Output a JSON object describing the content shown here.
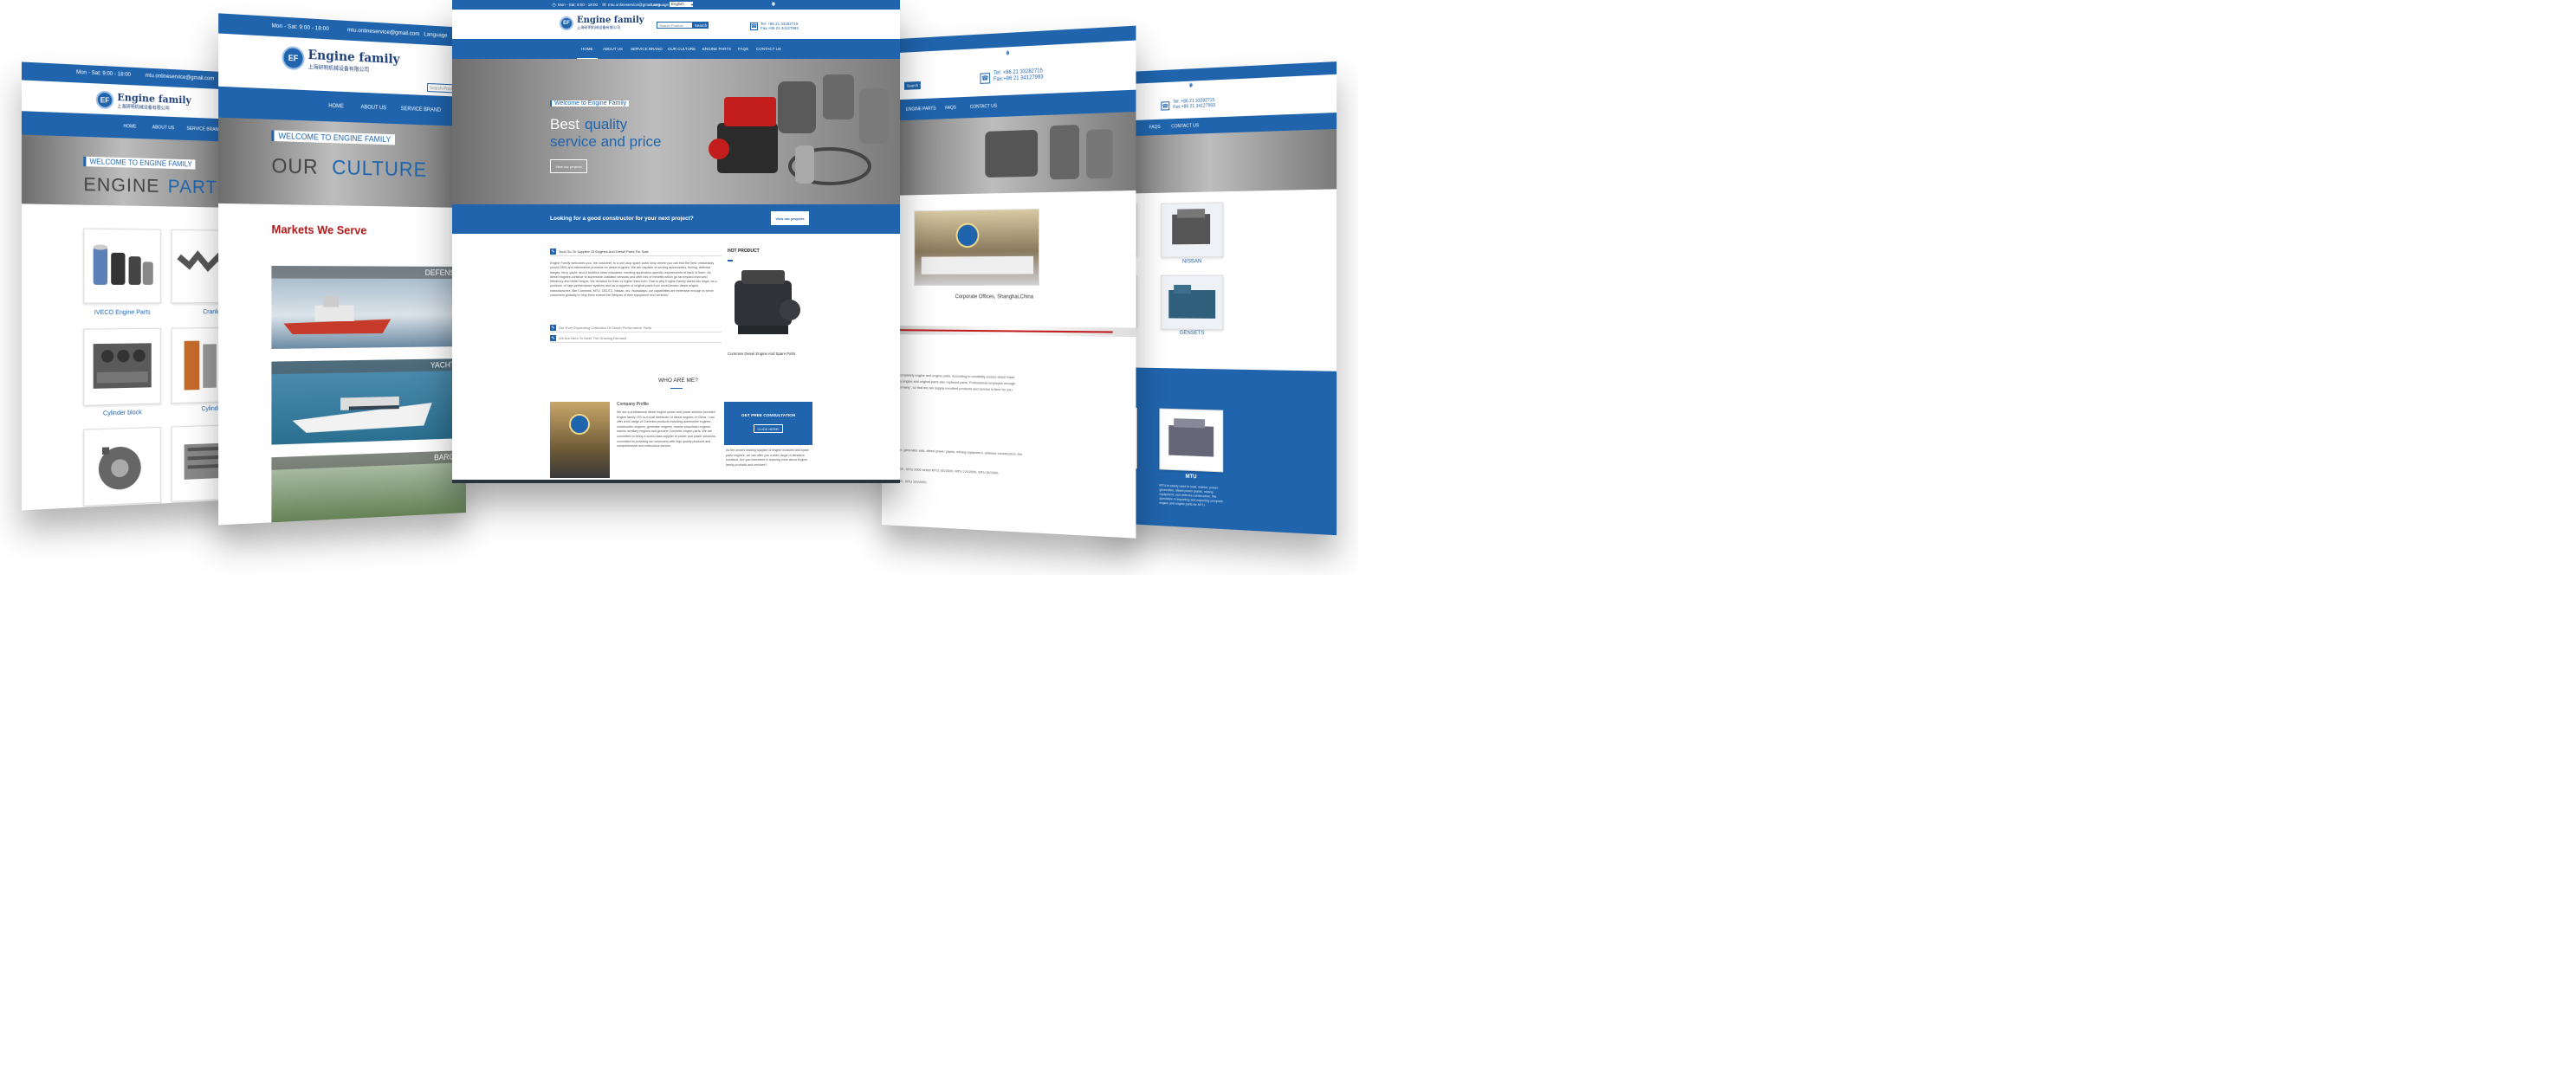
{
  "brand": {
    "name": "Engine family",
    "name_cn": "上海研明机械设备有限公司",
    "hours": "Mon - Sat: 9:00 - 18:00",
    "email": "mtu.onlineservice@gmail.com",
    "language_label": "Language",
    "language_value": "English",
    "search_placeholder": "Search Product",
    "search_button": "Search",
    "tel": "Tel: +86 21 33282715",
    "fax": "Fax:+86 21 34127993"
  },
  "colors": {
    "primary": "#1f64ad",
    "accent_red": "#c01d1d"
  },
  "social_icons": [
    "facebook-icon",
    "twitter-icon",
    "google-plus-icon",
    "pinterest-icon",
    "linkedin-icon"
  ],
  "center": {
    "nav": [
      "HOME",
      "ABOUT US",
      "SERVICE BRAND",
      "OUR CULTURE",
      "ENGINE PARTS",
      "FAQS",
      "CONTACT US"
    ],
    "hero": {
      "welcome": "Welcome to Engine Family",
      "line1a": "Best",
      "line1b": "quality",
      "line2": "service and price",
      "button": "View our projects"
    },
    "cta": {
      "text": "Looking for a good constructor for your next project?",
      "button": "View our projects"
    },
    "accordion": [
      {
        "title": "Your Go-To Supplier Of Engines And Diesel Parts For Sale"
      },
      {
        "title": "Our Ever-Expanding Collection Of Diesel Performance Parts"
      },
      {
        "title": "We Are Here To Meet The Growing Demand"
      }
    ],
    "intro_text": "Engine Family welcomes you, the customer, to a one-stop spare parts shop where you can find the best, reasonably priced OEM and aftermarket products for diesel engines. We are capable of serving automobiles, fishing, defense, barges, ferry, yacht, and a bevillion other industries, meeting application-specific requirements of each of them. As diesel engines continue to supersede outdated versions and offer lots of benefits which go far beyond improved efficiency and better torque, the demand for them is higher than ever. That is why Engine Family works two ways: as a producer of high-performance systems and as a supplier of original parts from world-known diesel engine manufacturers, like Cummins, MTU, DEUTZ, Nissan, etc. Nowadays, our capabilities are extensive enough to serve customers globally to help them extend the lifespan of their equipment and vehicles.",
    "hot_product": {
      "title": "HOT PRODUCT",
      "caption": "Cummins Diesel Engine And Spare Parts"
    },
    "who": {
      "title": "WHO ARE ME?",
      "profile_title": "Company Profile",
      "profile_text": "We are a professional diesel engine power and power solution provider! Engine family LTD is a local distributor of diesel engines in China. I can offer a full range of Cummins products including automotive engines, construction engines, generator engines, marine propulsion engines, marine auxiliary engines and genuine Cummins engine parts. We are committed to being a world-class supplier of power and power solutions, committed to providing our customers with high quality products and comprehensive and meticulous service.",
      "consult_title": "GET FREE CONSULTATION",
      "consult_button": "CLICK HERE!",
      "consult_text": "As the world's leading supplier of engine modules and spare parts engines, we can offer you a wide range of attractive solutions. Are you interested in learning more about Engine family products and services?"
    }
  },
  "left1": {
    "nav": [
      "HOME",
      "ABOUT US",
      "SERVICE BRAND"
    ],
    "welcome": "WELCOME TO ENGINE FAMILY",
    "title_a": "ENGINE",
    "title_b": "PART",
    "products": [
      {
        "label": "IVECO Engine Parts"
      },
      {
        "label": "Cranksh"
      },
      {
        "label": "Cylinder block"
      },
      {
        "label": "Cylinder"
      },
      {
        "label": ""
      },
      {
        "label": ""
      }
    ]
  },
  "left2": {
    "nav": [
      "HOME",
      "ABOUT US",
      "SERVICE BRAND"
    ],
    "welcome": "WELCOME TO ENGINE FAMILY",
    "title_a": "OUR",
    "title_b": "CULTURE",
    "markets_title": "Markets We Serve",
    "markets": [
      "DEFENSE",
      "YACHTS",
      "BARGE"
    ]
  },
  "right1": {
    "nav": [
      "ENGINE PARTS",
      "FAQS",
      "CONTACT US"
    ],
    "search_button": "Search",
    "office_caption": "Corporate Offices, Shanghai,China",
    "body_lines": [
      "ng for MTU completely engine and engine parts. According to credibility source which there",
      "for completely engine and original parts also replaced parts. Professional employee enough",
      "ness from Germany , so that we can supply excellent products and service in time for you."
    ],
    "lower_lines": [
      "mines, marine, generator sets, diesel power plants, mining equipment, defense construction, the",
      ", MTU16V2000 , MTU 2000 series MTU 16V2000, MTU 12V2000, MTU 8V2000,",
      "MTU 12V4000 , MTU 20V4000,"
    ]
  },
  "right2": {
    "nav": [
      "FAQS",
      "CONTACT US"
    ],
    "products": [
      {
        "label": "NISSAN"
      },
      {
        "label": "GENSETS"
      },
      {
        "label": "MTU"
      }
    ],
    "mtu_text": "MTU is widely used in road, marine, power generation, diesel power plants, mining equipment, and defense construction. We specialize in importing and exporting complete engine and engine parts for MTU."
  }
}
